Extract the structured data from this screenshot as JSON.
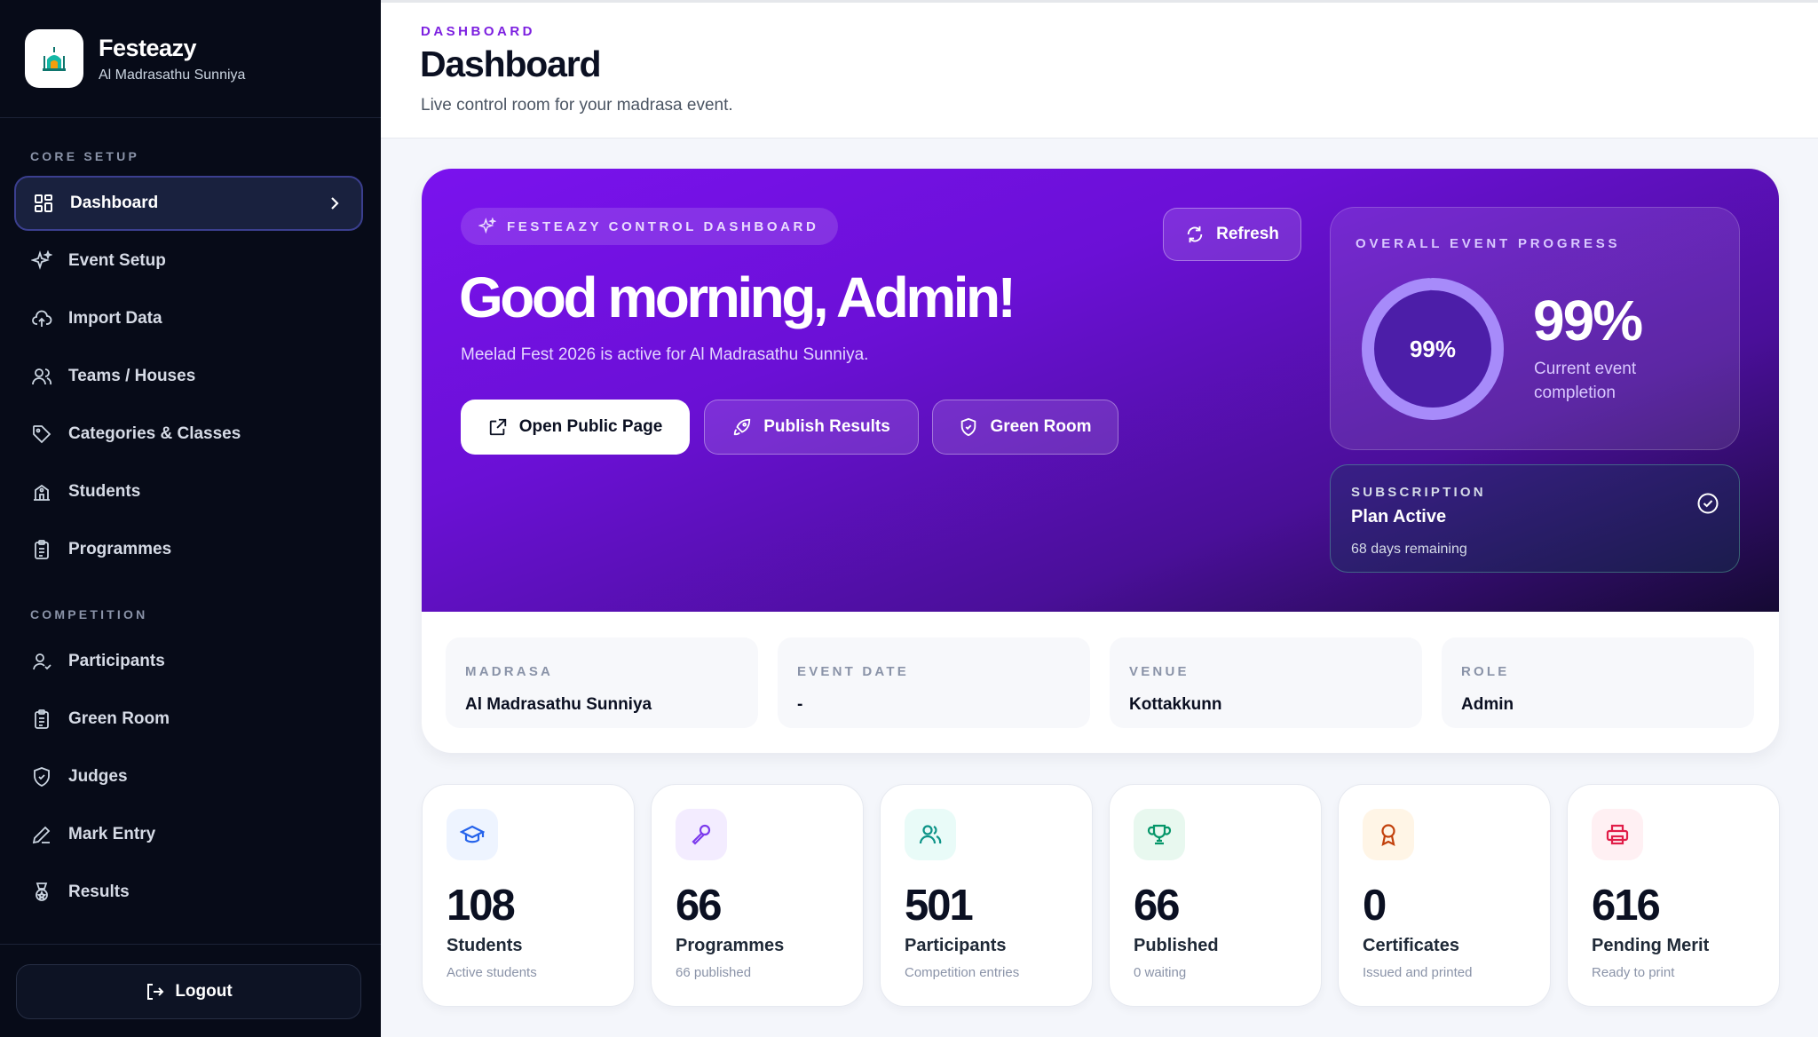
{
  "brand": {
    "name": "Festeazy",
    "subtitle": "Al Madrasathu Sunniya",
    "logo_icon": "mosque-icon"
  },
  "sidebar": {
    "section_core": "CORE SETUP",
    "section_competition": "COMPETITION",
    "items": [
      {
        "label": "Dashboard",
        "icon": "grid-icon",
        "active": true
      },
      {
        "label": "Event Setup",
        "icon": "sparkles-icon"
      },
      {
        "label": "Import Data",
        "icon": "cloud-upload-icon"
      },
      {
        "label": "Teams / Houses",
        "icon": "users-icon"
      },
      {
        "label": "Categories & Classes",
        "icon": "tag-icon"
      },
      {
        "label": "Students",
        "icon": "school-icon"
      },
      {
        "label": "Programmes",
        "icon": "clipboard-icon"
      },
      {
        "label": "Participants",
        "icon": "user-check-icon"
      },
      {
        "label": "Green Room",
        "icon": "clipboard-icon"
      },
      {
        "label": "Judges",
        "icon": "shield-icon"
      },
      {
        "label": "Mark Entry",
        "icon": "pen-icon"
      },
      {
        "label": "Results",
        "icon": "medal-icon"
      }
    ],
    "logout_label": "Logout"
  },
  "header": {
    "eyebrow": "DASHBOARD",
    "title": "Dashboard",
    "subtitle": "Live control room for your madrasa event."
  },
  "hero": {
    "badge": "FESTEAZY CONTROL DASHBOARD",
    "greeting": "Good morning, Admin!",
    "description": "Meelad Fest 2026 is active for Al Madrasathu Sunniya.",
    "open_public_label": "Open Public Page",
    "publish_label": "Publish Results",
    "green_room_label": "Green Room",
    "refresh_label": "Refresh",
    "progress": {
      "label": "OVERALL EVENT PROGRESS",
      "ring_text": "99%",
      "value_text": "99%",
      "value": 99,
      "caption": "Current event completion"
    },
    "subscription": {
      "label": "SUBSCRIPTION",
      "title": "Plan Active",
      "days": "68 days remaining"
    }
  },
  "info": [
    {
      "label": "MADRASA",
      "value": "Al Madrasathu Sunniya"
    },
    {
      "label": "EVENT DATE",
      "value": "-"
    },
    {
      "label": "VENUE",
      "value": "Kottakkunn"
    },
    {
      "label": "ROLE",
      "value": "Admin"
    }
  ],
  "stats": [
    {
      "number": "108",
      "label": "Students",
      "sub": "Active students",
      "icon": "graduation-cap-icon",
      "color": "#2563eb",
      "bg": "#eef4ff"
    },
    {
      "number": "66",
      "label": "Programmes",
      "sub": "66 published",
      "icon": "microphone-icon",
      "color": "#7c3aed",
      "bg": "#f3ecff"
    },
    {
      "number": "501",
      "label": "Participants",
      "sub": "Competition entries",
      "icon": "users-icon",
      "color": "#0d9488",
      "bg": "#e9fbf8"
    },
    {
      "number": "66",
      "label": "Published",
      "sub": "0 waiting",
      "icon": "trophy-icon",
      "color": "#059669",
      "bg": "#e8f8ef"
    },
    {
      "number": "0",
      "label": "Certificates",
      "sub": "Issued and printed",
      "icon": "award-icon",
      "color": "#c2410c",
      "bg": "#fff5e6"
    },
    {
      "number": "616",
      "label": "Pending Merit",
      "sub": "Ready to print",
      "icon": "printer-icon",
      "color": "#e11d48",
      "bg": "#fff0f3"
    }
  ]
}
